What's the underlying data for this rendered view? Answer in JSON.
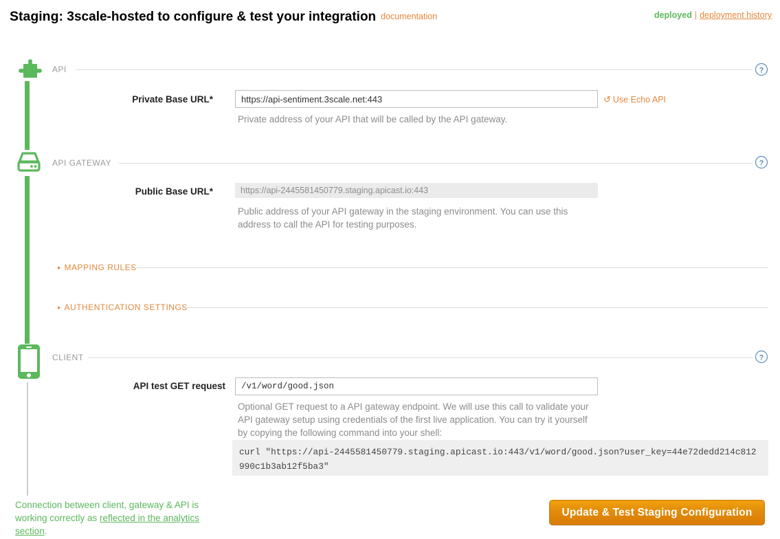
{
  "header": {
    "title_strong": "Staging:",
    "title_rest": "3scale-hosted to configure & test your integration",
    "documentation_link": "documentation",
    "deploy_status": "deployed",
    "separator": "|",
    "deployment_history_link": "deployment history"
  },
  "sections": {
    "api": {
      "label": "API",
      "icon": "puzzle-piece-icon",
      "help": "?",
      "field_label": "Private Base URL*",
      "field_value": "https://api-sentiment.3scale.net:443",
      "echo_link": "Use Echo API",
      "echo_icon": "↺",
      "hint": "Private address of your API that will be called by the API gateway."
    },
    "gateway": {
      "label": "API GATEWAY",
      "icon": "server-icon",
      "help": "?",
      "field_label": "Public Base URL*",
      "field_value": "https://api-2445581450779.staging.apicast.io:443",
      "hint": "Public address of your API gateway in the staging environment. You can use this address to call the API for testing purposes.",
      "mapping_rules_label": "MAPPING RULES",
      "authentication_settings_label": "AUTHENTICATION SETTINGS",
      "triangle": "▸"
    },
    "client": {
      "label": "CLIENT",
      "icon": "mobile-phone-icon",
      "help": "?",
      "field_label": "API test GET request",
      "field_value": "/v1/word/good.json",
      "hint": "Optional GET request to a API gateway endpoint. We will use this call to validate your API gateway setup using credentials of the first live application. You can try it yourself by copying the following command into your shell:",
      "curl_command": "curl \"https://api-2445581450779.staging.apicast.io:443/v1/word/good.json?user_key=44e72dedd214c812990c1b3ab12f5ba3\""
    }
  },
  "footer": {
    "status_prefix": "Connection between client, gateway & API is working correctly as ",
    "status_link": "reflected in the analytics section",
    "status_suffix": ".",
    "submit_label": "Update & Test Staging Configuration"
  },
  "colors": {
    "green": "#5cb85c",
    "orange": "#e3873c",
    "button_orange": "#e08a0a",
    "help_blue": "#4f86b5",
    "muted": "#8c8c8c"
  }
}
